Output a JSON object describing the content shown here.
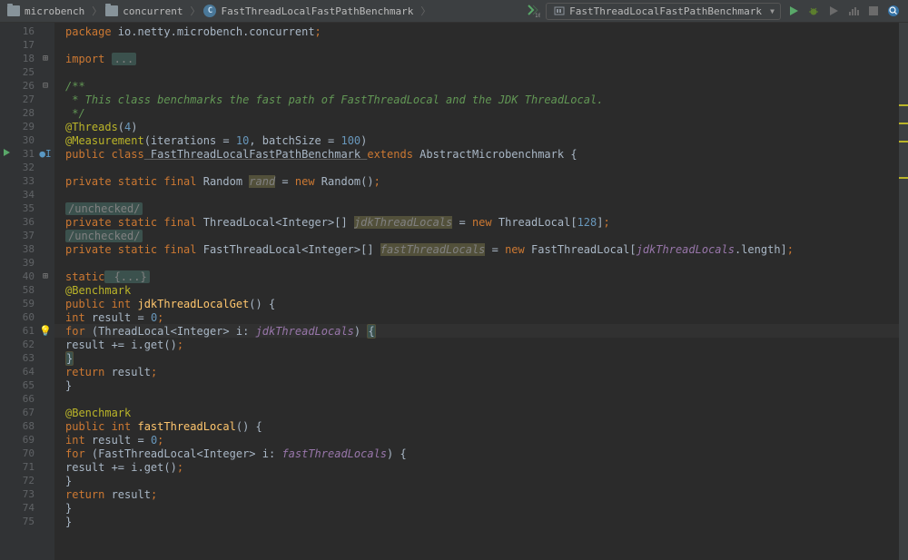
{
  "breadcrumb": {
    "items": [
      {
        "name": "microbench",
        "icon": "folder"
      },
      {
        "name": "concurrent",
        "icon": "folder"
      },
      {
        "name": "FastThreadLocalFastPathBenchmark",
        "icon": "class"
      }
    ]
  },
  "run_config": {
    "selected": "FastThreadLocalFastPathBenchmark"
  },
  "gutter_lines": [
    16,
    17,
    18,
    25,
    26,
    27,
    28,
    29,
    30,
    31,
    32,
    33,
    34,
    35,
    36,
    37,
    38,
    39,
    40,
    58,
    59,
    60,
    61,
    62,
    63,
    64,
    65,
    66,
    67,
    68,
    69,
    70,
    71,
    72,
    73,
    74,
    75
  ],
  "code": {
    "l16": {
      "t1": "package",
      "t2": " io.netty.microbench.concurrent",
      "t3": ";"
    },
    "l18": {
      "t1": "import",
      "t2": " ",
      "folded": "..."
    },
    "l26": "/**",
    "l27": " * This class benchmarks the fast path of FastThreadLocal and the JDK ThreadLocal.",
    "l28": " */",
    "l29": {
      "ann": "@Threads",
      "p1": "(",
      "num": "4",
      "p2": ")"
    },
    "l30": {
      "ann": "@Measurement",
      "body": "(iterations = ",
      "n1": "10",
      "mid": ", batchSize = ",
      "n2": "100",
      "end": ")"
    },
    "l31": {
      "k1": "public class",
      "cls": " FastThreadLocalFastPathBenchmark ",
      "k2": "extends",
      "sup": " AbstractMicrobenchmark {"
    },
    "l33": {
      "k1": "private static final",
      "cls": " Random ",
      "fld": "rand",
      "eq": " = ",
      "k2": "new",
      "ctor": " Random()",
      "semi": ";"
    },
    "l35": "/unchecked/",
    "l36": {
      "k1": "private static final",
      "cls": " ThreadLocal<Integer>[] ",
      "fld": "jdkThreadLocals",
      "eq": " = ",
      "k2": "new",
      "ctor": " ThreadLocal[",
      "num": "128",
      "end": "]",
      "semi": ";"
    },
    "l37": "/unchecked/",
    "l38": {
      "k1": "private static final",
      "cls": " FastThreadLocal<Integer>[] ",
      "fld": "fastThreadLocals",
      "eq": " = ",
      "k2": "new",
      "ctor": " FastThreadLocal[",
      "ref": "jdkThreadLocals",
      "end": ".length]",
      "semi": ";"
    },
    "l40": {
      "k1": "static",
      "folded": " {...}"
    },
    "l58": {
      "ann": "@Benchmark"
    },
    "l59": {
      "k1": "public int",
      "mth": " jdkThreadLocalGet",
      "body": "() {"
    },
    "l60": {
      "k1": "int",
      "body": " result = ",
      "num": "0",
      "semi": ";"
    },
    "l61": {
      "k1": "for",
      "body1": " (ThreadLocal<Integer> i: ",
      "ref": "jdkThreadLocals",
      "body2": ") ",
      "brace": "{"
    },
    "l62": {
      "body": "result += i.get()",
      "semi": ";"
    },
    "l63": {
      "brace": "}"
    },
    "l64": {
      "k1": "return",
      "body": " result",
      "semi": ";"
    },
    "l65": "}",
    "l67": {
      "ann": "@Benchmark"
    },
    "l68": {
      "k1": "public int",
      "mth": " fastThreadLocal",
      "body": "() {"
    },
    "l69": {
      "k1": "int",
      "body": " result = ",
      "num": "0",
      "semi": ";"
    },
    "l70": {
      "k1": "for",
      "body1": " (FastThreadLocal<Integer> i: ",
      "ref": "fastThreadLocals",
      "body2": ") {"
    },
    "l71": {
      "body": "result += i.get()",
      "semi": ";"
    },
    "l72": "}",
    "l73": {
      "k1": "return",
      "body": " result",
      "semi": ";"
    },
    "l74": "}",
    "l75": "}"
  }
}
